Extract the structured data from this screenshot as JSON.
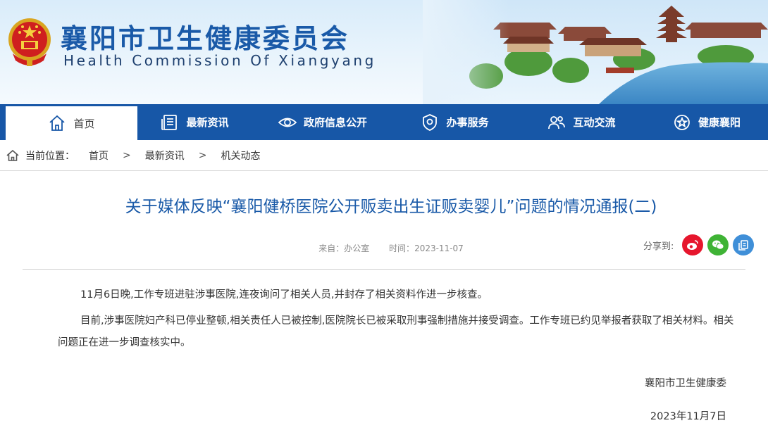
{
  "header": {
    "title": "襄阳市卫生健康委员会",
    "subtitle": "Health Commission Of Xiangyang"
  },
  "nav": {
    "items": [
      {
        "label": "首页"
      },
      {
        "label": "最新资讯"
      },
      {
        "label": "政府信息公开"
      },
      {
        "label": "办事服务"
      },
      {
        "label": "互动交流"
      },
      {
        "label": "健康襄阳"
      }
    ]
  },
  "breadcrumb": {
    "prefix": "当前位置：",
    "items": [
      "首页",
      "最新资讯",
      "机关动态"
    ],
    "separator": ">"
  },
  "article": {
    "title": "关于媒体反映“襄阳健桥医院公开贩卖出生证贩卖婴儿”问题的情况通报(二)",
    "source_label": "来自：",
    "source": "办公室",
    "time_label": "时间：",
    "time": "2023-11-07",
    "paragraphs": [
      "11月6日晚,工作专班进驻涉事医院,连夜询问了相关人员,并封存了相关资料作进一步核查。",
      "目前,涉事医院妇产科已停业整顿,相关责任人已被控制,医院院长已被采取刑事强制措施并接受调查。工作专班已约见举报者获取了相关材料。相关问题正在进一步调查核实中。"
    ],
    "signature": "襄阳市卫生健康委",
    "date": "2023年11月7日"
  },
  "share": {
    "label": "分享到:",
    "buttons": [
      {
        "icon": "weibo-icon",
        "color": "#e6162d"
      },
      {
        "icon": "wechat-icon",
        "color": "#3fb335"
      },
      {
        "icon": "copy-icon",
        "color": "#3f8fd8"
      }
    ]
  },
  "colors": {
    "brand_blue": "#1757a7",
    "title_blue": "#1a5aa8"
  }
}
